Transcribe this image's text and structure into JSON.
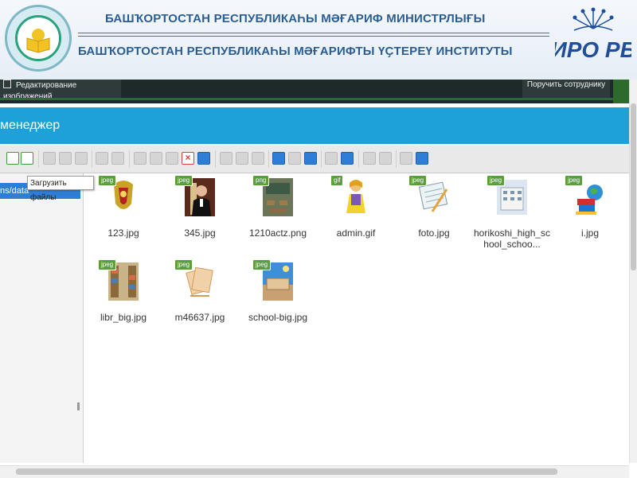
{
  "banner": {
    "ministry_title": "БАШҠОРТОСТАН РЕСПУБЛИКАҺЫ МӘҒАРИФ МИНИСТРЛЫҒЫ",
    "institute_title": "БАШҠОРТОСТАН РЕСПУБЛИКАҺЫ МӘҒАРИФТЫ ҮҪТЕРЕҮ ИНСТИТУТЫ",
    "left_logo": "book-emblem-logo",
    "right_logo": "iro-rb-logo",
    "right_logo_text": "ИРО РБ"
  },
  "topbar": {
    "edit_images": "Редактирование изображений",
    "send_to_employee": "Поручить сотруднику"
  },
  "manager": {
    "title": "менеджер"
  },
  "tree": {
    "selected_path": "ns/data"
  },
  "toolbar": {
    "tooltip": "Загрузить файлы"
  },
  "files": [
    {
      "name": "123.jpg",
      "type": "jpeg",
      "icon": "coat-of-arms-thumb"
    },
    {
      "name": "345.jpg",
      "type": "jpeg",
      "icon": "judge-portrait-thumb"
    },
    {
      "name": "1210actz.png",
      "type": "png",
      "icon": "classroom-thumb"
    },
    {
      "name": "admin.gif",
      "type": "gif",
      "icon": "cartoon-woman-thumb"
    },
    {
      "name": "foto.jpg",
      "type": "jpeg",
      "icon": "calendar-pencil-thumb"
    },
    {
      "name": "horikoshi_high_school_schoo...",
      "type": "jpeg",
      "icon": "school-building-thumb"
    },
    {
      "name": "i.jpg",
      "type": "jpeg",
      "icon": "globe-books-thumb"
    },
    {
      "name": "libr_big.jpg",
      "type": "jpeg",
      "icon": "library-shelves-thumb"
    },
    {
      "name": "m46637.jpg",
      "type": "jpeg",
      "icon": "paper-stack-thumb"
    },
    {
      "name": "school-big.jpg",
      "type": "jpeg",
      "icon": "school-blue-sky-thumb"
    }
  ],
  "colors": {
    "banner_text": "#2b5d93",
    "header_blue": "#1ea1d9",
    "selection_blue": "#2f7ed6",
    "badge_green": "#5a9e3e"
  }
}
